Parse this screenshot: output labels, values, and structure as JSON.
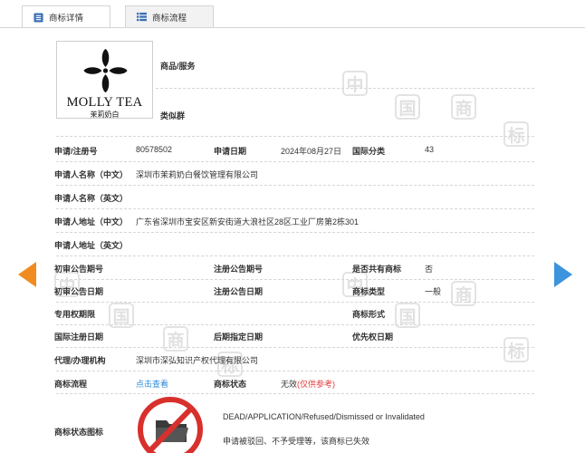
{
  "tabs": {
    "details": "商标详情",
    "flow": "商标流程"
  },
  "logo": {
    "brand_text": "MOLLY TEA",
    "brand_cn": "茉莉奶白"
  },
  "side_fields": {
    "goods_label": "商品/服务",
    "similar_label": "类似群"
  },
  "rows": {
    "reg_no_label": "申请/注册号",
    "reg_no": "80578502",
    "app_date_label": "申请日期",
    "app_date": "2024年08月27日",
    "intl_class_label": "国际分类",
    "intl_class": "43",
    "applicant_cn_label": "申请人名称（中文）",
    "applicant_cn": "深圳市茉莉奶白餐饮管理有限公司",
    "applicant_en_label": "申请人名称（英文）",
    "address_cn_label": "申请人地址（中文）",
    "address_cn": "广东省深圳市宝安区新安街道大浪社区28区工业厂房第2栋301",
    "address_en_label": "申请人地址（英文）",
    "prelim_pub_no_label": "初审公告期号",
    "reg_pub_no_label": "注册公告期号",
    "shared_label": "是否共有商标",
    "shared": "否",
    "prelim_pub_date_label": "初审公告日期",
    "reg_pub_date_label": "注册公告日期",
    "type_label": "商标类型",
    "type": "一般",
    "exclusive_period_label": "专用权期限",
    "form_label": "商标形式",
    "intl_reg_date_label": "国际注册日期",
    "later_date_label": "后期指定日期",
    "priority_date_label": "优先权日期",
    "agent_label": "代理/办理机构",
    "agent": "深圳市深弘知识产权代理有限公司",
    "flow_label": "商标流程",
    "flow_link": "点击查看",
    "status_label": "商标状态",
    "status": "无效",
    "status_note": "(仅供参考)",
    "status_icon_label": "商标状态图标",
    "status_en": "DEAD/APPLICATION/Refused/Dismissed or Invalidated",
    "status_cn": "申请被驳回、不予受理等，该商标已失效"
  },
  "watermark_char_1": "中",
  "watermark_char_2": "国",
  "watermark_char_3": "商",
  "watermark_char_4": "标",
  "colors": {
    "link": "#2b8ad8",
    "status_red": "#e23b3b",
    "prev_arrow": "#f08c1f",
    "next_arrow": "#3c94dc"
  }
}
